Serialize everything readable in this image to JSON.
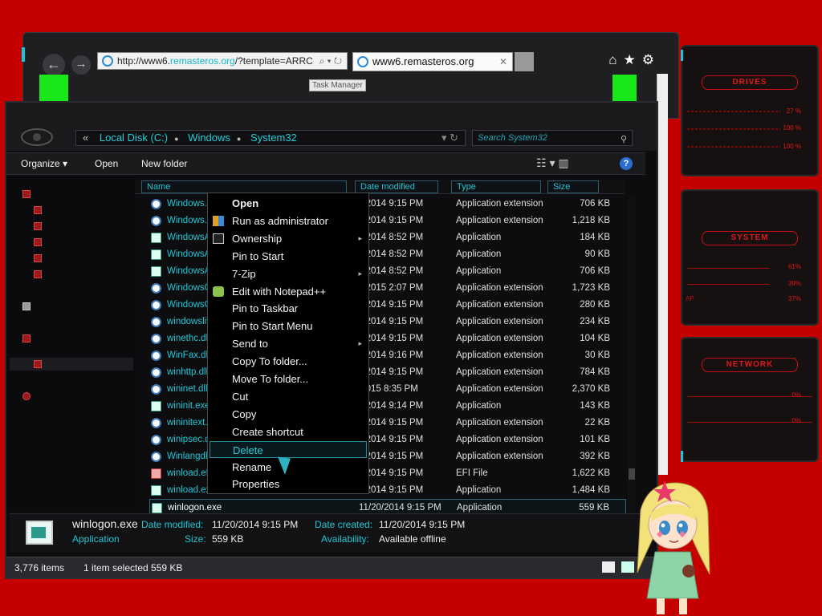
{
  "browser": {
    "url_prefix": "http://www6.",
    "url_host": "remasteros.org",
    "url_suffix": "/?template=ARRC",
    "url_controls": "⌕ ▾ ↻",
    "tab_title": "www6.remasteros.org",
    "tab_close": "✕",
    "back": "←",
    "forward": "→",
    "tools": "⌂★⚙",
    "task_tooltip": "Task Manager"
  },
  "widgets": {
    "drives": {
      "title": "DRIVES",
      "values": [
        "27 %",
        "100 %",
        "100 %"
      ]
    },
    "system": {
      "title": "SYSTEM",
      "values": [
        "61%",
        "39%",
        "37%"
      ],
      "side_label": "AP"
    },
    "network": {
      "title": "NETWORK",
      "values": [
        "0%",
        "0%"
      ]
    }
  },
  "explorer": {
    "breadcrumb": [
      "Local Disk (C:)",
      "Windows",
      "System32"
    ],
    "breadcrumb_lead": "«",
    "crumb_controls": "▾  ↻",
    "search_placeholder": "Search System32",
    "search_icon": "⚲",
    "toolbar": {
      "organize": "Organize ▾",
      "open": "Open",
      "new_folder": "New folder",
      "view_icons": "☷ ▾  ▥",
      "help": "?"
    },
    "columns": [
      "Name",
      "Date modified",
      "Type",
      "Size"
    ],
    "files": [
      {
        "name": "Windows.",
        "date": "0/2014 9:15 PM",
        "type": "Application extension",
        "size": "706 KB",
        "icon": "dll"
      },
      {
        "name": "Windows.",
        "date": "0/2014 9:15 PM",
        "type": "Application extension",
        "size": "1,218 KB",
        "icon": "dll"
      },
      {
        "name": "WindowsA",
        "date": "0/2014 8:52 PM",
        "type": "Application",
        "size": "184 KB",
        "icon": "app"
      },
      {
        "name": "WindowsA",
        "date": "0/2014 8:52 PM",
        "type": "Application",
        "size": "90 KB",
        "icon": "app"
      },
      {
        "name": "WindowsA",
        "date": "0/2014 8:52 PM",
        "type": "Application",
        "size": "706 KB",
        "icon": "app"
      },
      {
        "name": "WindowsC",
        "date": "0/2015 2:07 PM",
        "type": "Application extension",
        "size": "1,723 KB",
        "icon": "dll"
      },
      {
        "name": "WindowsC",
        "date": "0/2014 9:15 PM",
        "type": "Application extension",
        "size": "280 KB",
        "icon": "dll"
      },
      {
        "name": "windowsliv",
        "date": "0/2014 9:15 PM",
        "type": "Application extension",
        "size": "234 KB",
        "icon": "dll"
      },
      {
        "name": "winethc.dll",
        "date": "0/2014 9:15 PM",
        "type": "Application extension",
        "size": "104 KB",
        "icon": "dll"
      },
      {
        "name": "WinFax.dll",
        "date": "0/2014 9:16 PM",
        "type": "Application extension",
        "size": "30 KB",
        "icon": "dll"
      },
      {
        "name": "winhttp.dll",
        "date": "0/2014 9:15 PM",
        "type": "Application extension",
        "size": "784 KB",
        "icon": "dll"
      },
      {
        "name": "wininet.dll",
        "date": "/2015 8:35 PM",
        "type": "Application extension",
        "size": "2,370 KB",
        "icon": "dll"
      },
      {
        "name": "wininit.exe",
        "date": "0/2014 9:14 PM",
        "type": "Application",
        "size": "143 KB",
        "icon": "app"
      },
      {
        "name": "wininitext.d",
        "date": "0/2014 9:15 PM",
        "type": "Application extension",
        "size": "22 KB",
        "icon": "dll"
      },
      {
        "name": "winipsec.d",
        "date": "0/2014 9:15 PM",
        "type": "Application extension",
        "size": "101 KB",
        "icon": "dll"
      },
      {
        "name": "Winlangdb",
        "date": "0/2014 9:15 PM",
        "type": "Application extension",
        "size": "392 KB",
        "icon": "dll"
      },
      {
        "name": "winload.efi",
        "date": "0/2014 9:15 PM",
        "type": "EFI File",
        "size": "1,622 KB",
        "icon": "efi"
      },
      {
        "name": "winload.exe",
        "date": "0/2014 9:15 PM",
        "type": "Application",
        "size": "1,484 KB",
        "icon": "app"
      },
      {
        "name": "winlogon.exe",
        "date": "11/20/2014 9:15 PM",
        "type": "Application",
        "size": "559 KB",
        "icon": "app"
      }
    ],
    "context_menu": [
      "Open",
      "Run as administrator",
      "Ownership",
      "Pin to Start",
      "7-Zip",
      "Edit with Notepad++",
      "Pin to Taskbar",
      "Pin to Start Menu",
      "Send to",
      "Copy To folder...",
      "Move To folder...",
      "Cut",
      "Copy",
      "Create shortcut",
      "Delete",
      "Rename",
      "Properties"
    ],
    "submenu_arrow": "▸",
    "details": {
      "filename": "winlogon.exe",
      "filetype": "Application",
      "date_modified_label": "Date modified:",
      "date_modified": "11/20/2014 9:15 PM",
      "date_created_label": "Date created:",
      "date_created": "11/20/2014 9:15 PM",
      "size_label": "Size:",
      "size": "559 KB",
      "availability_label": "Availability:",
      "availability": "Available offline"
    },
    "status": {
      "items": "3,776 items",
      "selected": "1 item selected  559 KB"
    }
  },
  "colors": {
    "accent": "#1ec6d4",
    "background": "#c40000",
    "highlight_green": "#18e818"
  }
}
